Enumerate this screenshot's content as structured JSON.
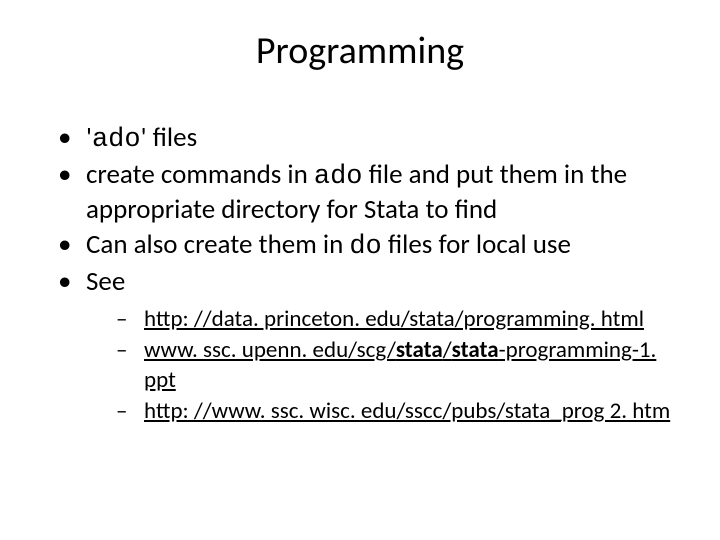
{
  "title": "Programming",
  "bullets": {
    "b1_pre": "'",
    "b1_code": "ado",
    "b1_post": "' files",
    "b2_pre": "create commands in ",
    "b2_code": "ado",
    "b2_post": " file and put them in the appropriate directory for Stata to find",
    "b3_pre": "Can also create them in ",
    "b3_code": "do",
    "b3_post": " files for local use",
    "b4": "See"
  },
  "links": {
    "l1": "http: //data. princeton. edu/stata/programming. html",
    "l2_pre": "www. ssc. upenn. edu/scg/",
    "l2_b1": "stata",
    "l2_mid": "/",
    "l2_b2": "stata",
    "l2_post": "-programming-1. ppt",
    "l3": "http: //www. ssc. wisc. edu/sscc/pubs/stata_prog 2. htm"
  }
}
